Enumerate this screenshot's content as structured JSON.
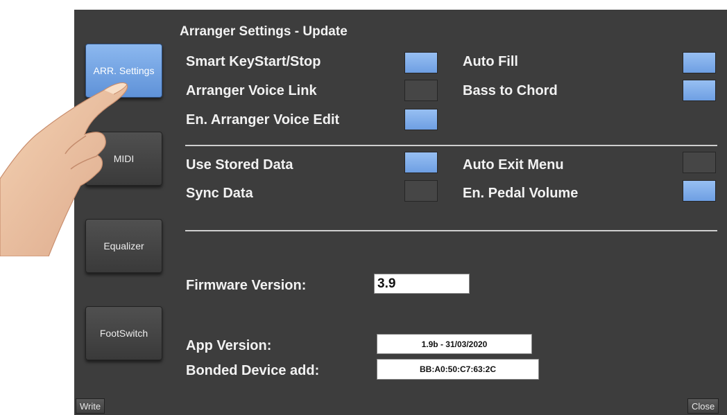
{
  "screen_title": "Arranger Settings - Update",
  "nav": [
    {
      "label": "ARR. Settings",
      "active": true
    },
    {
      "label": "MIDI",
      "active": false
    },
    {
      "label": "Equalizer",
      "active": false
    },
    {
      "label": "FootSwitch",
      "active": false
    }
  ],
  "settings": {
    "smart_keystart": {
      "label": "Smart KeyStart/Stop",
      "state": "on"
    },
    "arranger_voice_link": {
      "label": "Arranger Voice Link",
      "state": "off"
    },
    "en_arranger_voice_edit": {
      "label": "En. Arranger Voice  Edit",
      "state": "on"
    },
    "auto_fill": {
      "label": "Auto Fill",
      "state": "on"
    },
    "bass_to_chord": {
      "label": "Bass to Chord",
      "state": "on"
    },
    "use_stored_data": {
      "label": "Use Stored Data",
      "state": "on"
    },
    "sync_data": {
      "label": "Sync Data",
      "state": "off"
    },
    "auto_exit_menu": {
      "label": "Auto Exit Menu",
      "state": "off"
    },
    "en_pedal_volume": {
      "label": "En. Pedal Volume",
      "state": "on"
    }
  },
  "info": {
    "firmware_label": "Firmware Version:",
    "firmware_value": "3.9",
    "app_label": "App Version:",
    "app_value": "1.9b - 31/03/2020",
    "bonded_label": "Bonded Device add:",
    "bonded_value": "BB:A0:50:C7:63:2C"
  },
  "bottom": {
    "write": "Write",
    "close": "Close"
  },
  "colors": {
    "panel": "#3d3d3d",
    "toggle_on": "#7aa9e8",
    "toggle_off": "#464646"
  },
  "overlay": {
    "icon": "pointing-hand-icon"
  }
}
